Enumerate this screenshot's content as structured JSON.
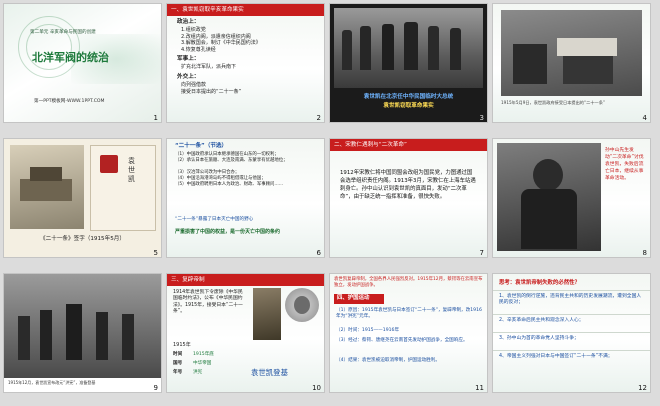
{
  "slides": [
    {
      "num": "1",
      "subtitle": "第二单元 辛亥革命与民国的创建",
      "title": "北洋军阀的统治",
      "footer": "第一PPT模板网-WWW.1PPT.COM"
    },
    {
      "num": "2",
      "header": "一、袁世凯窃取辛亥革命果实",
      "lines": [
        "政治上：",
        "1.组织政党",
        "2.改组内阁，派遣亲信组织内阁",
        "3.解散国会，制订《中华民国约法》",
        "4.恢复尊孔读经",
        "军事上：",
        "扩充北洋军队，派兵南下",
        "外交上：",
        "向列强借款",
        "接受日本提出的“二十一条”"
      ]
    },
    {
      "num": "3",
      "caption1": "袁世凯在北京任中华民国临时大总统",
      "caption2": "袁世凯窃取革命果实"
    },
    {
      "num": "4",
      "caption": "1915年5月9日，袁世凯政府接受日本提出的“二十一条”"
    },
    {
      "num": "5",
      "seal_text": "袁世凯",
      "caption": "《二十一条》签字（1915年5月）"
    },
    {
      "num": "6",
      "header": "“二十一条”（节选）",
      "lines": [
        "（1）中国政府承认日本继承德国在山东的一切权利；",
        "（2）承认日本在旅顺、大连及南满、东蒙享有优越地位；",
        "（3）汉冶萍公司改为中日合办；",
        "（4）中国沿海港湾岛屿不得租借或让与他国；",
        "（5）中国政府聘用日本人为政治、财政、军事顾问……"
      ],
      "question": "“二十一条”暴露了日本灭亡中国的野心",
      "answer": "严重损害了中国的权益，是一份灭亡中国的条约"
    },
    {
      "num": "7",
      "header": "二、宋教仁遇刺与“二次革命”",
      "body": "1912年宋教仁将中国同盟会改组为国民党，力图通过国会选举组织责任内阁。1913年3月，宋教仁在上海车站遇刺身亡。孙中山认识到袁世凯的真面目，发动“二次革命”，由于缺乏统一指挥和准备，很快失败。"
    },
    {
      "num": "8",
      "side_text": "孙中山先生发动“二次革命”讨伐袁世凯，失败后流亡日本，继续从事革命活动。"
    },
    {
      "num": "9",
      "caption": "1915年12月，袁世凯宣布改元“洪宪”，准备登基"
    },
    {
      "num": "10",
      "header": "三、复辟帝制",
      "body": "1914年袁世凯下令废除《中华民国临时约法》，公布《中华民国约法》。1915年，接受日本“二十一条”。",
      "year_label": "1915年",
      "rows": [
        [
          "时间",
          "1915年底"
        ],
        [
          "国号",
          "中华帝国"
        ],
        [
          "年号",
          "洪宪"
        ]
      ],
      "signature": "袁世凯登基"
    },
    {
      "num": "11",
      "top_text": "袁世凯复辟帝制，全国各界人民强烈反对。1915年12月，蔡锷等在云南宣布独立，发动护国战争。",
      "header": "四、护国运动",
      "lines": [
        "（1）原因：1915年袁世凯与日本签订“二十一条”，复辟帝制，改1916年为“洪宪”元年。",
        "（2）时间：1915——1916年",
        "（3）经过：蔡锷、唐继尧在云南首先发动护国战争，全国响应。",
        "（4）结果：袁世凯被迫取消帝制，护国运动胜利。"
      ]
    },
    {
      "num": "12",
      "title": "思考：袁世凯帝制失败的必然性？",
      "lines": [
        "1、袁世凯的倒行逆施，违背民主共和的历史发展潮流，遭到全国人民的反对；",
        "2、辛亥革命后民主共和观念深入人心；",
        "3、孙中山为首的革命党人坚持斗争；",
        "4、帝国主义列强对日本与中国签订“二十一条”不满；"
      ]
    }
  ],
  "colors": {
    "accent_red": "#c81d1d",
    "title_green": "#1e7a3c",
    "answer_green": "#1b6b2e",
    "caption_blue": "#1b4fa0"
  }
}
